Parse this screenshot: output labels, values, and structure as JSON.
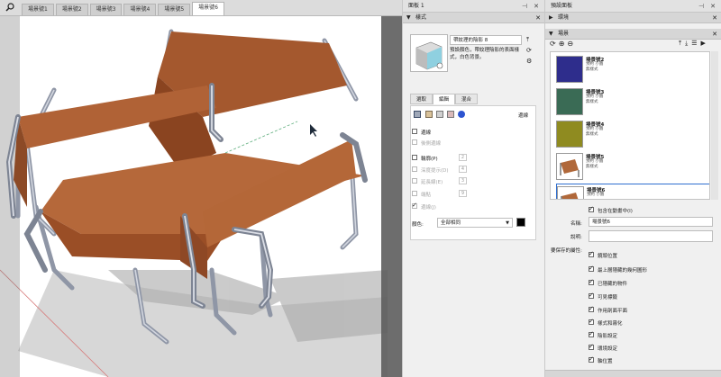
{
  "viewport": {
    "scene_tabs": [
      "場景號1",
      "場景號2",
      "場景號3",
      "場景號4",
      "場景號5",
      "場景號6"
    ],
    "active_tab_index": 5
  },
  "tray1": {
    "title": "面板 1",
    "styles_section": "樣式",
    "style_name": "帶紋理的陰影 8",
    "style_description": "預設顏色，帶紋理陰影的表面樣式，白色背景。",
    "tabs": [
      "選取",
      "編輯",
      "混合"
    ],
    "active_tab": "編輯",
    "edge_heading": "邊線",
    "edges": "邊線",
    "back_edges": "後側邊線",
    "profiles": "輪廓(P)",
    "profiles_value": "2",
    "depth_cue": "深度提示(D)",
    "depth_cue_value": "4",
    "extension": "延長線(E)",
    "extension_value": "3",
    "endpoints": "端點",
    "endpoints_value": "9",
    "jitter": "邊線(J)",
    "color_label": "顏色:",
    "color_value": "全部相同",
    "color_swatch": "#000000"
  },
  "tray2": {
    "title": "預設面板",
    "environment_section": "環境",
    "scenes_section": "場景",
    "scenes": [
      {
        "name": "場景號2",
        "desc": "預約 小圖\n無樣式",
        "color": "#2e2d8c"
      },
      {
        "name": "場景號3",
        "desc": "預約 小圖\n無樣式",
        "color": "#3a6b55"
      },
      {
        "name": "場景號4",
        "desc": "預約 小圖\n無樣式",
        "color": "#8f8b20"
      },
      {
        "name": "場景號5",
        "desc": "預約 小圖\n無樣式",
        "color": "#ffffff"
      },
      {
        "name": "場景號6",
        "desc": "預約 小圖",
        "color": "#ffffff"
      }
    ],
    "include_in_animation": "包含在動畫中(I)",
    "name_label": "名稱:",
    "name_value": "場景號6",
    "desc_label": "說明:",
    "desc_value": "",
    "props_label": "要保存的屬性:",
    "props": [
      "鏡頭位置",
      "最上層隱藏的幾何圖形",
      "已隱藏的物件",
      "可見標籤",
      "作用剖面平面",
      "樣式和霧化",
      "陰影設定",
      "環境設定",
      "軸位置"
    ]
  }
}
